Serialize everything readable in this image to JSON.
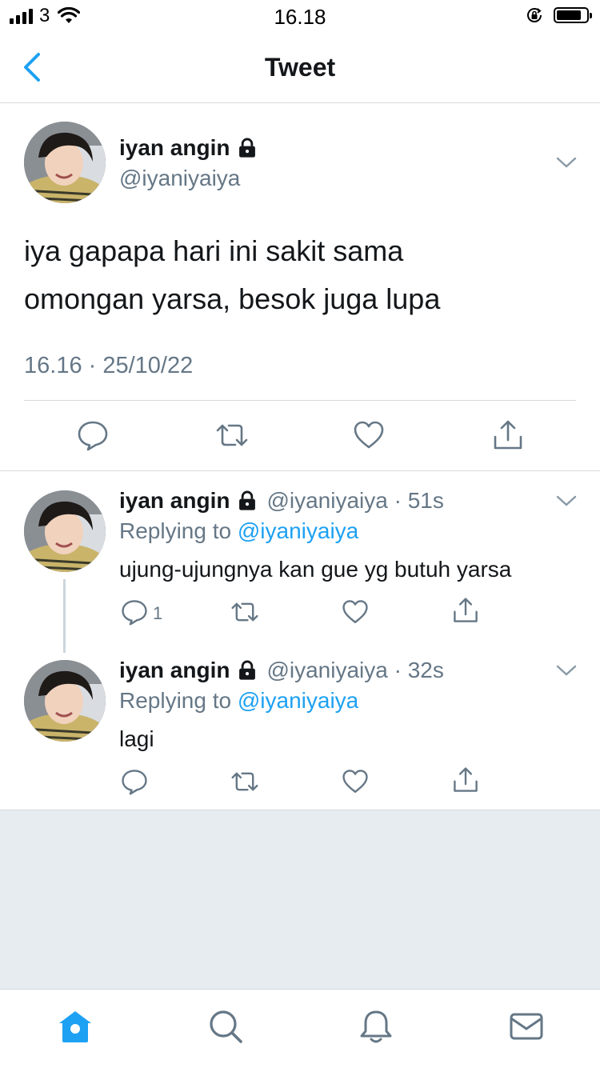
{
  "status_bar": {
    "carrier": "3",
    "time": "16.18"
  },
  "nav": {
    "title": "Tweet"
  },
  "main_tweet": {
    "name": "iyan angin",
    "handle": "@iyaniyaiya",
    "text_line1": "iya gapapa hari ini sakit sama",
    "text_line2": "omongan yarsa, besok juga lupa",
    "timestamp": "16.16 · 25/10/22"
  },
  "replies": [
    {
      "name": "iyan angin",
      "handle_time": "@iyaniyaiya · 51s",
      "replying_prefix": "Replying to",
      "replying_handle": "@iyaniyaiya",
      "text": "ujung-ujungnya kan gue yg butuh yarsa",
      "reply_count": "1"
    },
    {
      "name": "iyan angin",
      "handle_time": "@iyaniyaiya · 32s",
      "replying_prefix": "Replying to",
      "replying_handle": "@iyaniyaiya",
      "text": "lagi",
      "reply_count": ""
    }
  ],
  "icons": {
    "tab_bar": [
      "home-icon",
      "search-icon",
      "bell-icon",
      "mail-icon"
    ],
    "actions": [
      "reply-icon",
      "retweet-icon",
      "like-icon",
      "share-icon"
    ]
  },
  "colors": {
    "accent": "#1da1f2",
    "muted": "#657786",
    "text": "#14171a",
    "background_gray": "#e6ecf0"
  }
}
